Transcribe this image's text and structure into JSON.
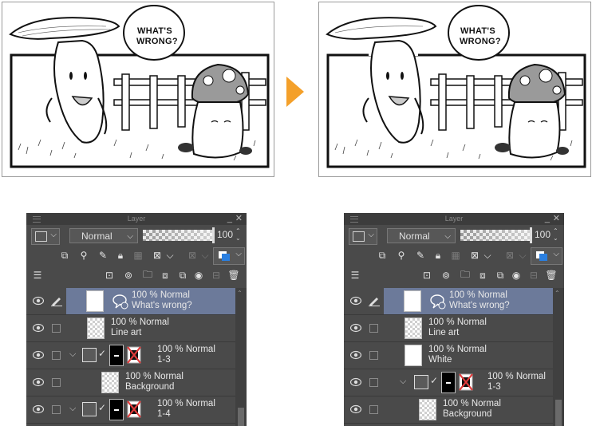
{
  "comic": {
    "before": {
      "speech": [
        "WHAT'S",
        "WRONG?"
      ]
    },
    "after": {
      "speech": [
        "WHAT'S",
        "WRONG?"
      ]
    },
    "arrow_color": "#f4a02a"
  },
  "panels": [
    {
      "title": "Layer",
      "blend_mode": "Normal",
      "opacity": "100",
      "opacity_fraction": 1.0,
      "layers": [
        {
          "kind": "comic",
          "percent": "100 %",
          "mode": "Normal",
          "name": "What's wrong?",
          "selected": true
        },
        {
          "kind": "raster",
          "percent": "100 %",
          "mode": "Normal",
          "name": "Line art"
        },
        {
          "kind": "folder",
          "percent": "100 %",
          "mode": "Normal",
          "name": "1-3"
        },
        {
          "kind": "raster-indent",
          "percent": "100 %",
          "mode": "Normal",
          "name": "Background"
        },
        {
          "kind": "folder",
          "percent": "100 %",
          "mode": "Normal",
          "name": "1-4"
        }
      ]
    },
    {
      "title": "Layer",
      "blend_mode": "Normal",
      "opacity": "100",
      "opacity_fraction": 1.0,
      "layers": [
        {
          "kind": "comic",
          "percent": "100 %",
          "mode": "Normal",
          "name": "What's wrong?",
          "selected": true
        },
        {
          "kind": "raster",
          "percent": "100 %",
          "mode": "Normal",
          "name": "Line art"
        },
        {
          "kind": "white",
          "percent": "100 %",
          "mode": "Normal",
          "name": "White"
        },
        {
          "kind": "folder",
          "percent": "100 %",
          "mode": "Normal",
          "name": "1-3"
        },
        {
          "kind": "raster-indent",
          "percent": "100 %",
          "mode": "Normal",
          "name": "Background"
        }
      ]
    }
  ],
  "colors": {
    "panel_bg": "#4a4a4a",
    "selected_row": "#6c7a9a",
    "accent_blue": "#2a7fe0",
    "mask_x": "#e23b3b"
  }
}
